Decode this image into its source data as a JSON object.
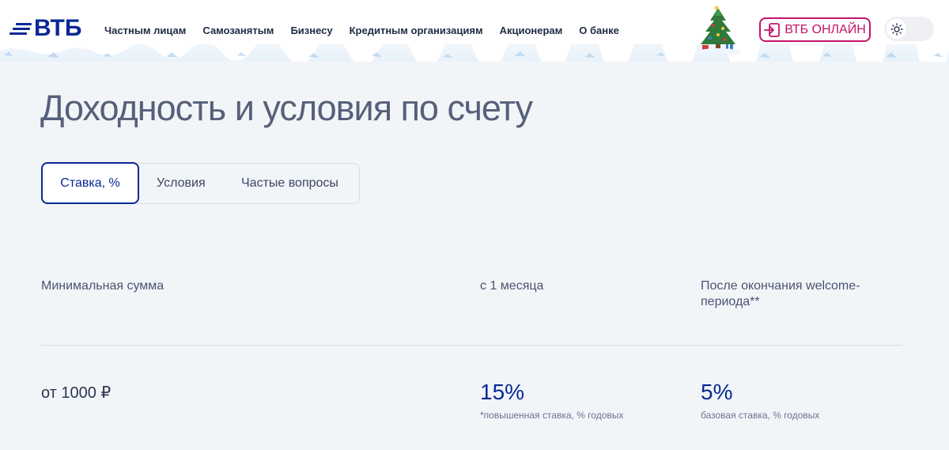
{
  "header": {
    "logo_text": "ВТБ",
    "nav": [
      {
        "label": "Частным лицам"
      },
      {
        "label": "Самозанятым"
      },
      {
        "label": "Бизнесу"
      },
      {
        "label": "Кредитным организациям"
      },
      {
        "label": "Акционерам"
      },
      {
        "label": "О банке"
      }
    ],
    "online_button_label": "ВТБ ОНЛАЙН",
    "accent_color": "#c4156c",
    "brand_color": "#0a2896"
  },
  "main": {
    "title": "Доходность и условия по счету",
    "tabs": [
      {
        "label": "Ставка, %",
        "active": true
      },
      {
        "label": "Условия",
        "active": false
      },
      {
        "label": "Частые вопросы",
        "active": false
      }
    ],
    "table": {
      "headers": [
        "Минимальная сумма",
        "с 1 месяца",
        "После окончания welcome-периода**"
      ],
      "row": {
        "min_sum": "от 1000 ₽",
        "rate_1": "15%",
        "rate_1_note": "*повышенная ставка, % годовых",
        "rate_2": "5%",
        "rate_2_note": "базовая ставка, % годовых"
      }
    }
  }
}
